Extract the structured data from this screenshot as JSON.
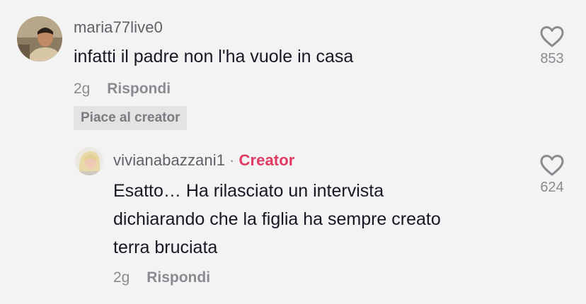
{
  "comments": [
    {
      "username": "maria77live0",
      "text": "infatti il padre non l'ha vuole in casa",
      "time": "2g",
      "reply_label": "Rispondi",
      "liked_by_creator": "Piace al creator",
      "likes": "853"
    }
  ],
  "reply": {
    "username": "vivianabazzani1",
    "separator": "·",
    "role_badge": "Creator",
    "text_lines": [
      "Esatto… Ha rilasciato un intervista",
      "dichiarando che la figlia ha sempre creato",
      "terra bruciata"
    ],
    "time": "2g",
    "reply_label": "Rispondi",
    "likes": "624"
  },
  "colors": {
    "background": "#f3f3f3",
    "creator_accent": "#e03a63",
    "secondary_text": "#8a8b91"
  },
  "icons": [
    "heart-outline-icon"
  ]
}
